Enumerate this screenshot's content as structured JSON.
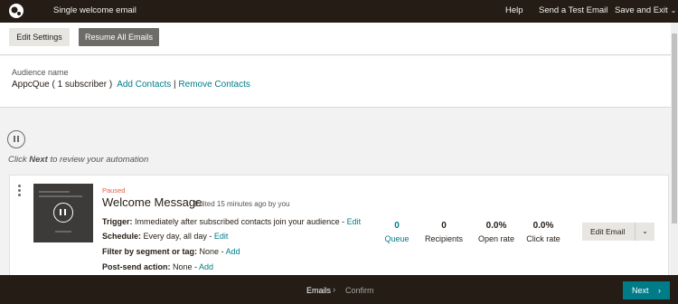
{
  "topbar": {
    "title": "Single welcome email",
    "help": "Help",
    "send_test": "Send a Test Email",
    "save_exit": "Save and Exit",
    "save_exit_caret": "⌄"
  },
  "toolbar": {
    "edit_settings": "Edit Settings",
    "resume_all": "Resume All Emails"
  },
  "audience": {
    "label": "Audience name",
    "name": "AppcQue ( 1 subscriber )",
    "add_contacts": "Add Contacts",
    "separator": "|",
    "remove_contacts": "Remove Contacts"
  },
  "automation": {
    "hint_prefix": "Click ",
    "hint_bold": "Next",
    "hint_suffix": " to review your automation"
  },
  "email_card": {
    "status": "Paused",
    "name": "Welcome Message",
    "edited": "Edited 15 minutes ago by you",
    "trigger_label": "Trigger:",
    "trigger_value": " Immediately after subscribed contacts join your audience - ",
    "schedule_label": "Schedule:",
    "schedule_value": " Every day, all day - ",
    "filter_label": "Filter by segment or tag:",
    "filter_value": " None - ",
    "post_send_label": "Post-send action:",
    "post_send_value": " None - ",
    "edit_link": "Edit",
    "add_link": "Add",
    "stats": {
      "queue_value": "0",
      "queue_label": "Queue",
      "recipients_value": "0",
      "recipients_label": "Recipients",
      "open_rate_value": "0.0%",
      "open_rate_label": "Open rate",
      "click_rate_value": "0.0%",
      "click_rate_label": "Click rate"
    },
    "edit_email": "Edit Email",
    "edit_email_caret": "⌄"
  },
  "footer": {
    "step_emails": "Emails",
    "step_separator": "›",
    "step_confirm": "Confirm",
    "next": "Next",
    "next_chevron": "›"
  },
  "colors": {
    "dark": "#241c15",
    "teal": "#007c89",
    "paused": "#e85c41"
  }
}
